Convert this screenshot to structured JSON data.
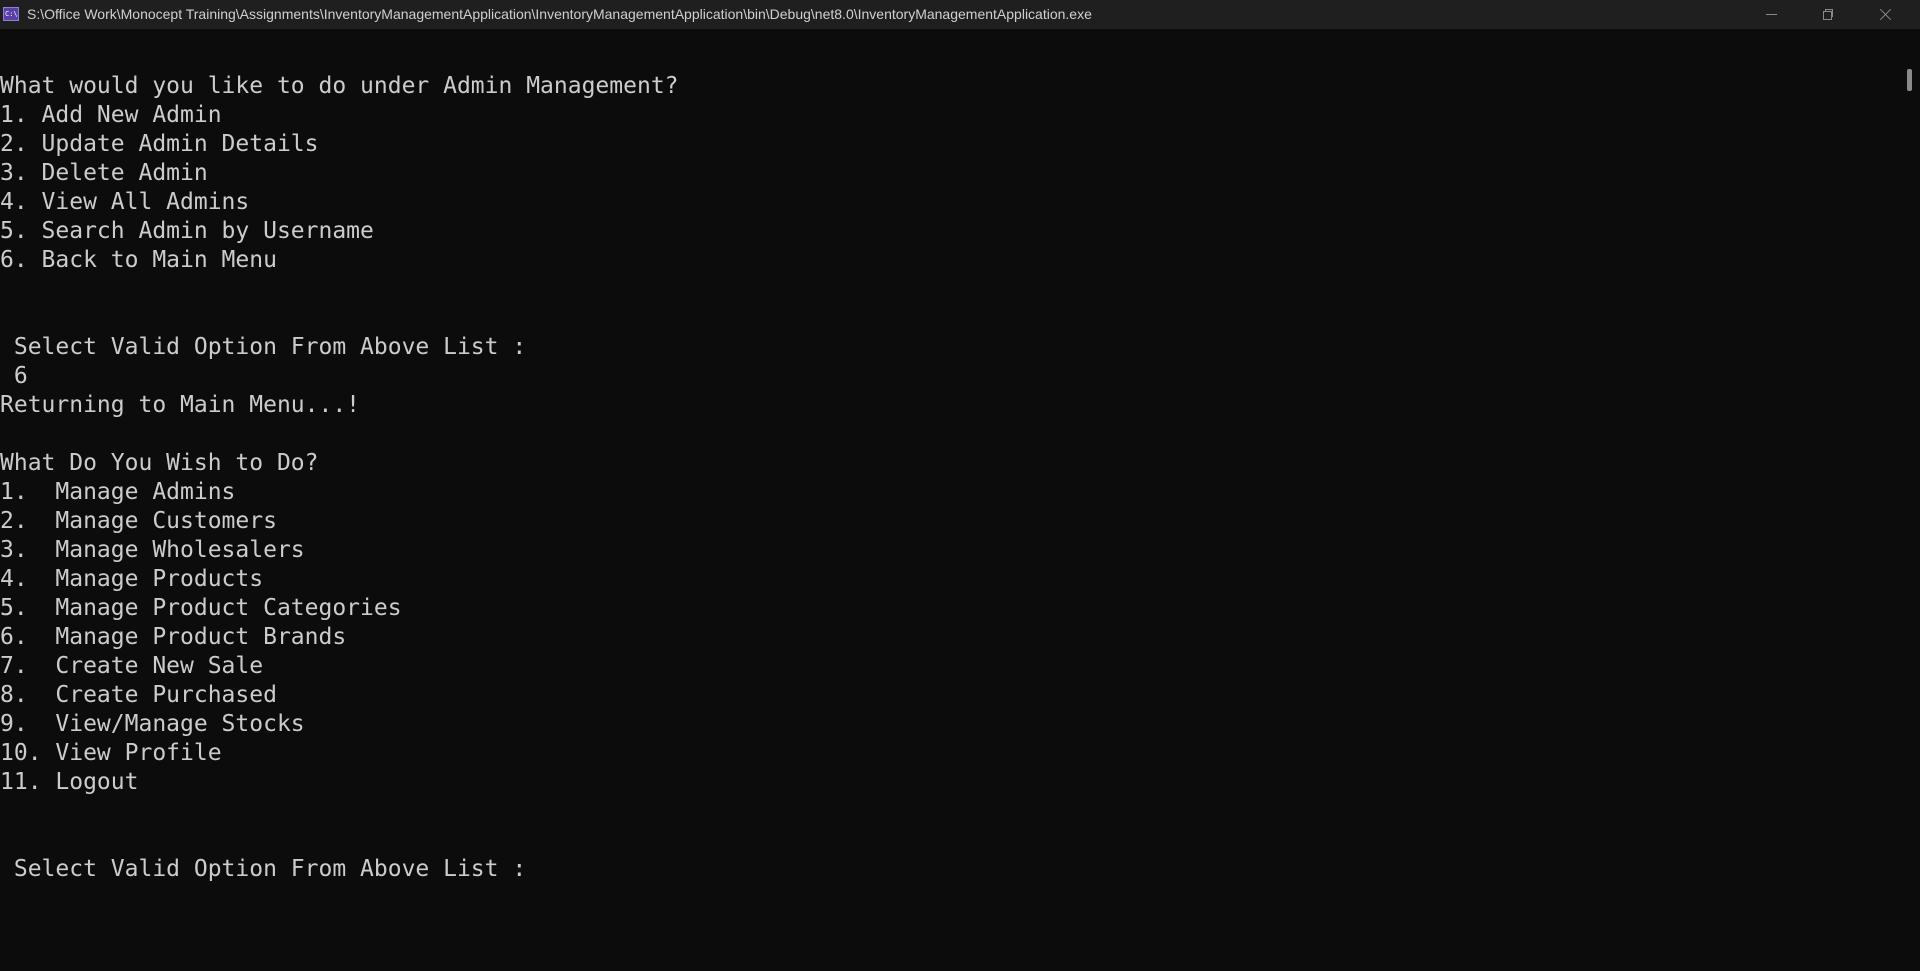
{
  "window": {
    "title": "S:\\Office Work\\Monocept Training\\Assignments\\InventoryManagementApplication\\InventoryManagementApplication\\bin\\Debug\\net8.0\\InventoryManagementApplication.exe",
    "app_icon_text": "C:\\",
    "icons": {
      "app": "console-app-icon",
      "minimize": "minimize-icon",
      "maximize": "restore-icon",
      "close": "close-icon"
    }
  },
  "console": {
    "admin_menu": {
      "prompt": "What would you like to do under Admin Management?",
      "options": [
        "1. Add New Admin",
        "2. Update Admin Details",
        "3. Delete Admin",
        "4. View All Admins",
        "5. Search Admin by Username",
        "6. Back to Main Menu"
      ],
      "select_prompt": " Select Valid Option From Above List :",
      "user_input": " 6",
      "result_message": "Returning to Main Menu...!"
    },
    "main_menu": {
      "prompt": "What Do You Wish to Do?",
      "options": [
        "1.  Manage Admins",
        "2.  Manage Customers",
        "3.  Manage Wholesalers",
        "4.  Manage Products",
        "5.  Manage Product Categories",
        "6.  Manage Product Brands",
        "7.  Create New Sale",
        "8.  Create Purchased",
        "9.  View/Manage Stocks",
        "10. View Profile",
        "11. Logout"
      ],
      "select_prompt": " Select Valid Option From Above List :"
    },
    "colors": {
      "background": "#0c0c0c",
      "text": "#cccccc",
      "titlebar": "#1f1f1f"
    }
  }
}
